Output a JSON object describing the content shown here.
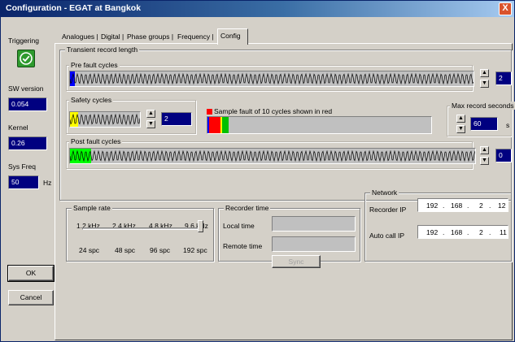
{
  "window": {
    "title": "Configuration - EGAT at Bangkok",
    "close_glyph": "X"
  },
  "sidebar": {
    "triggering_label": "Triggering",
    "triggering_icon": "check-icon",
    "sw_version_label": "SW version",
    "sw_version_value": "0.054",
    "kernel_label": "Kernel",
    "kernel_value": "0.26",
    "sys_freq_label": "Sys Freq",
    "sys_freq_value": "50",
    "sys_freq_unit": "Hz",
    "ok_label": "OK",
    "cancel_label": "Cancel"
  },
  "tabs": [
    {
      "label": "Analogues",
      "active": false
    },
    {
      "label": "Digital",
      "active": false
    },
    {
      "label": "Phase groups",
      "active": false
    },
    {
      "label": "Frequency",
      "active": false
    },
    {
      "label": "Config",
      "active": true
    }
  ],
  "transient": {
    "group_title": "Transient record length",
    "pre_fault": {
      "label": "Pre fault cycles",
      "value": "2",
      "fill_fraction": 0.012,
      "fill_color": "#0000ff"
    },
    "safety": {
      "label": "Safety cycles",
      "value": "2",
      "fill_fraction": 0.12,
      "fill_color": "#ffff00"
    },
    "sample_fault": {
      "label": "Sample fault of 10 cycles shown in red",
      "marker_color": "#ff0000",
      "segments": [
        {
          "color": "#0000ff",
          "fraction": 0.005
        },
        {
          "color": "#ff0000",
          "fraction": 0.05
        },
        {
          "color": "#ffff00",
          "fraction": 0.005
        },
        {
          "color": "#00c000",
          "fraction": 0.03
        }
      ]
    },
    "max_record": {
      "label": "Max record seconds",
      "value": "60",
      "unit": "s"
    },
    "post_fault": {
      "label": "Post fault cycles",
      "value": "0",
      "fill_fraction": 0.052,
      "fill_color": "#00ff00"
    },
    "spin_up_glyph": "⌂",
    "spin_down_glyph": "⌂"
  },
  "sample_rate": {
    "group_title": "Sample rate",
    "rates": [
      "1.2 kHz",
      "2.4 kHz",
      "4.8 kHz",
      "9.6 kHz"
    ],
    "spc": [
      "24 spc",
      "48 spc",
      "96 spc",
      "192 spc"
    ],
    "selected_index": 3
  },
  "recorder_time": {
    "group_title": "Recorder time",
    "local_label": "Local time",
    "remote_label": "Remote time",
    "sync_label": "Sync"
  },
  "network": {
    "group_title": "Network",
    "recorder_ip_label": "Recorder IP",
    "recorder_ip": [
      "192",
      "168",
      "2",
      "12"
    ],
    "auto_call_ip_label": "Auto call IP",
    "auto_call_ip": [
      "192",
      "168",
      "2",
      "11"
    ],
    "separator": "."
  }
}
